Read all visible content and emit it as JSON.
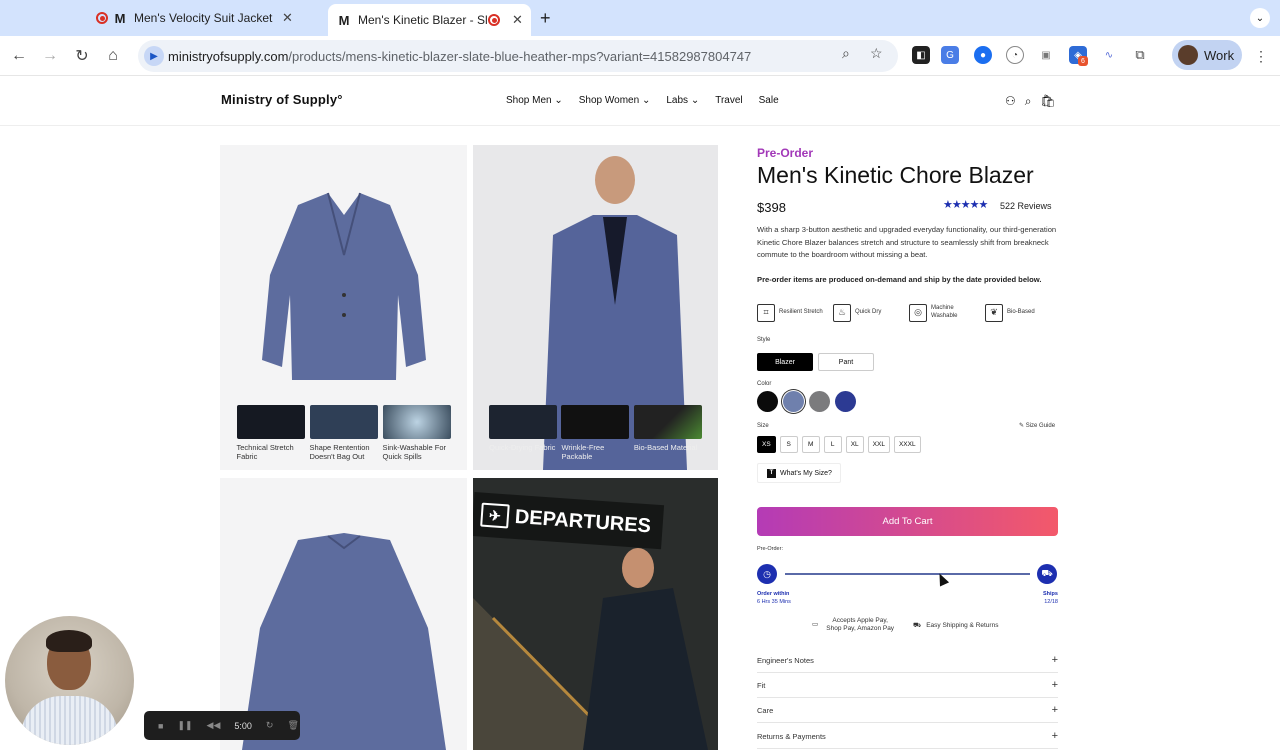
{
  "browser": {
    "tabs": [
      {
        "title": "Men's Velocity Suit Jacket - E",
        "favicon": "M"
      },
      {
        "title": "Men's Kinetic Blazer - Sla",
        "favicon": "M"
      }
    ],
    "url_host": "ministryofsupply.com",
    "url_path": "/products/mens-kinetic-blazer-slate-blue-heather-mps?variant=41582987804747",
    "extension_badge": "6",
    "profile_label": "Work"
  },
  "site": {
    "logo": "Ministry of Supply°",
    "nav": [
      "Shop Men",
      "Shop Women",
      "Labs",
      "Travel",
      "Sale"
    ]
  },
  "gallery": {
    "img1_thumbs": [
      {
        "caption": "Technical Stretch Fabric"
      },
      {
        "caption": "Shape Rentention Doesn't Bag Out"
      },
      {
        "caption": "Sink-Washable For Quick Spills"
      }
    ],
    "img2_thumbs": [
      {
        "caption": "Quick-Drying Fabric"
      },
      {
        "caption": "Wrinkle-Free Packable"
      },
      {
        "caption": "Bio-Based Material"
      }
    ],
    "departures_sign": "DEPARTURES"
  },
  "product": {
    "tag": "Pre-Order",
    "title": "Men's Kinetic Chore Blazer",
    "price": "$398",
    "stars": "★★★★★",
    "reviews": "522 Reviews",
    "description": "With a sharp 3-button aesthetic and upgraded everyday functionality, our third-generation Kinetic Chore Blazer balances stretch and structure to seamlessly shift from breakneck commute to the boardroom without missing a beat.",
    "preorder_note": "Pre-order items are produced on-demand and ship by the date provided below.",
    "features": [
      {
        "label": "Resilient Stretch",
        "icon": "stretch-icon"
      },
      {
        "label": "Quick Dry",
        "icon": "quick-dry-icon"
      },
      {
        "label": "Machine Washable",
        "icon": "washer-icon"
      },
      {
        "label": "Bio-Based",
        "icon": "leaf-icon"
      }
    ],
    "style_label": "Style",
    "styles": [
      "Blazer",
      "Pant"
    ],
    "color_label": "Color",
    "colors": [
      "#0b0b0b",
      "#6f80ad",
      "#7b7b7d",
      "#2c3a93"
    ],
    "size_label": "Size",
    "size_guide": "Size Guide",
    "sizes": [
      "XS",
      "S",
      "M",
      "L",
      "XL",
      "XXL",
      "XXXL"
    ],
    "whats_my_size": "What's My Size?",
    "add_to_cart": "Add To Cart",
    "preorder_label": "Pre-Order:",
    "order_within_title": "Order within",
    "order_within_value": "6 Hrs 35 Mins",
    "ships_title": "Ships",
    "ships_value": "12/18",
    "payments": "Accepts Apple Pay, Shop Pay, Amazon Pay",
    "shipping": "Easy Shipping & Returns",
    "accordions": [
      "Engineer's Notes",
      "Fit",
      "Care",
      "Returns & Payments"
    ]
  },
  "recorder": {
    "time": "5:00"
  }
}
